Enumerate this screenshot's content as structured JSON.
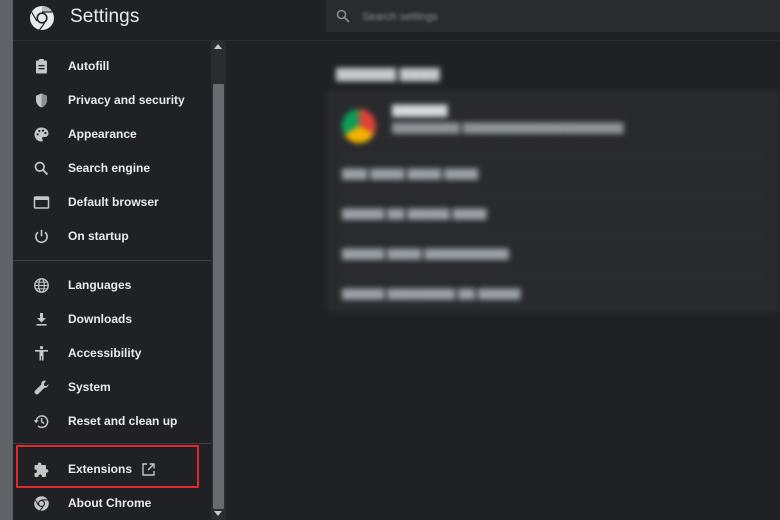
{
  "header": {
    "title": "Settings",
    "search_placeholder": "Search settings",
    "logo_icon": "chrome-logo-icon"
  },
  "sidebar": {
    "group1": [
      {
        "label": "Autofill",
        "icon": "clipboard-icon"
      },
      {
        "label": "Privacy and security",
        "icon": "shield-icon"
      },
      {
        "label": "Appearance",
        "icon": "palette-icon"
      },
      {
        "label": "Search engine",
        "icon": "search-icon"
      },
      {
        "label": "Default browser",
        "icon": "browser-window-icon"
      },
      {
        "label": "On startup",
        "icon": "power-icon"
      }
    ],
    "group2": [
      {
        "label": "Languages",
        "icon": "globe-icon"
      },
      {
        "label": "Downloads",
        "icon": "download-icon"
      },
      {
        "label": "Accessibility",
        "icon": "accessibility-icon"
      },
      {
        "label": "System",
        "icon": "wrench-icon"
      },
      {
        "label": "Reset and clean up",
        "icon": "history-reset-icon"
      }
    ],
    "group3": [
      {
        "label": "Extensions",
        "icon": "puzzle-icon",
        "external_icon": "open-in-new-icon"
      },
      {
        "label": "About Chrome",
        "icon": "chrome-icon"
      }
    ],
    "highlight_color": "#e0282e"
  },
  "colors": {
    "background": "#202124",
    "text": "#e8eaed",
    "icon": "#c4c7c5"
  }
}
